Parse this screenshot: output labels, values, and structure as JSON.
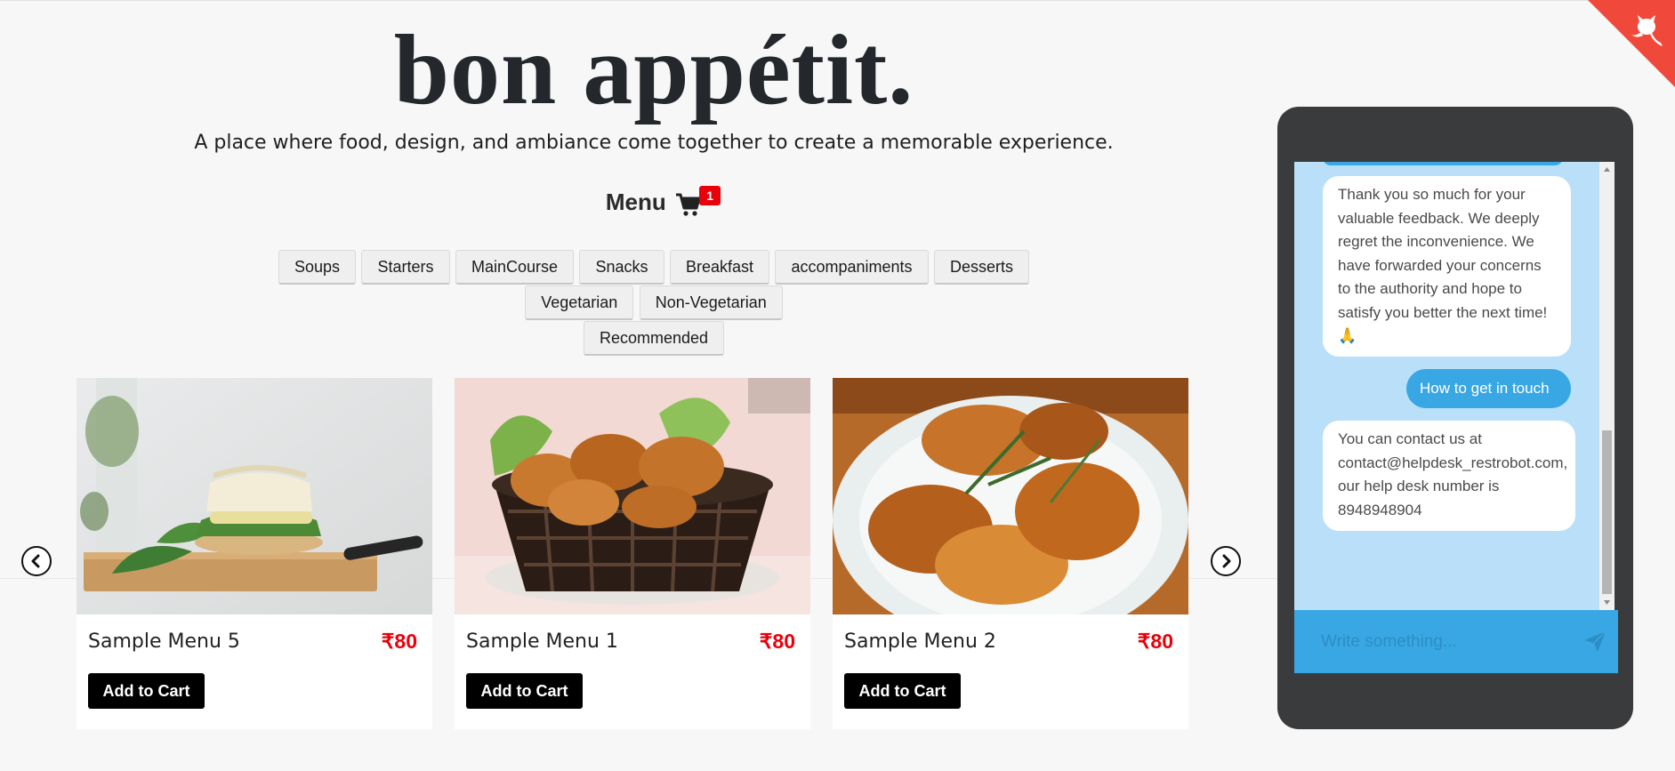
{
  "header": {
    "title": "bon appétit.",
    "tagline": "A place where food, design, and ambiance come together to create a memorable experience."
  },
  "menu": {
    "label": "Menu",
    "cart_count": "1"
  },
  "categories": {
    "row1": [
      "Soups",
      "Starters",
      "MainCourse",
      "Snacks",
      "Breakfast",
      "accompaniments",
      "Desserts"
    ],
    "row2": [
      "Vegetarian",
      "Non-Vegetarian"
    ],
    "row3": [
      "Recommended"
    ]
  },
  "cards": [
    {
      "name": "Sample Menu 5",
      "price": "₹80",
      "button": "Add to Cart"
    },
    {
      "name": "Sample Menu 1",
      "price": "₹80",
      "button": "Add to Cart"
    },
    {
      "name": "Sample Menu 2",
      "price": "₹80",
      "button": "Add to Cart"
    }
  ],
  "chat": {
    "messages": [
      {
        "from": "bot",
        "text": "Thank you so much for your valuable feedback. We deeply regret the inconvenience. We have forwarded your concerns to the authority and hope to satisfy you better the next time! 🙏"
      },
      {
        "from": "user",
        "text": "How to get in touch"
      },
      {
        "from": "bot",
        "text": "You can contact us at contact@helpdesk_restrobot.com, our help desk number is 8948948904"
      }
    ],
    "input_placeholder": "Write something..."
  },
  "colors": {
    "accent_red": "#e8000b",
    "chat_bg": "#b9e0f8",
    "chat_blue": "#38a7e3",
    "phone_frame": "#3a3b3d"
  },
  "icons": [
    "cart-icon",
    "prev-arrow-icon",
    "next-arrow-icon",
    "send-icon",
    "github-icon"
  ]
}
